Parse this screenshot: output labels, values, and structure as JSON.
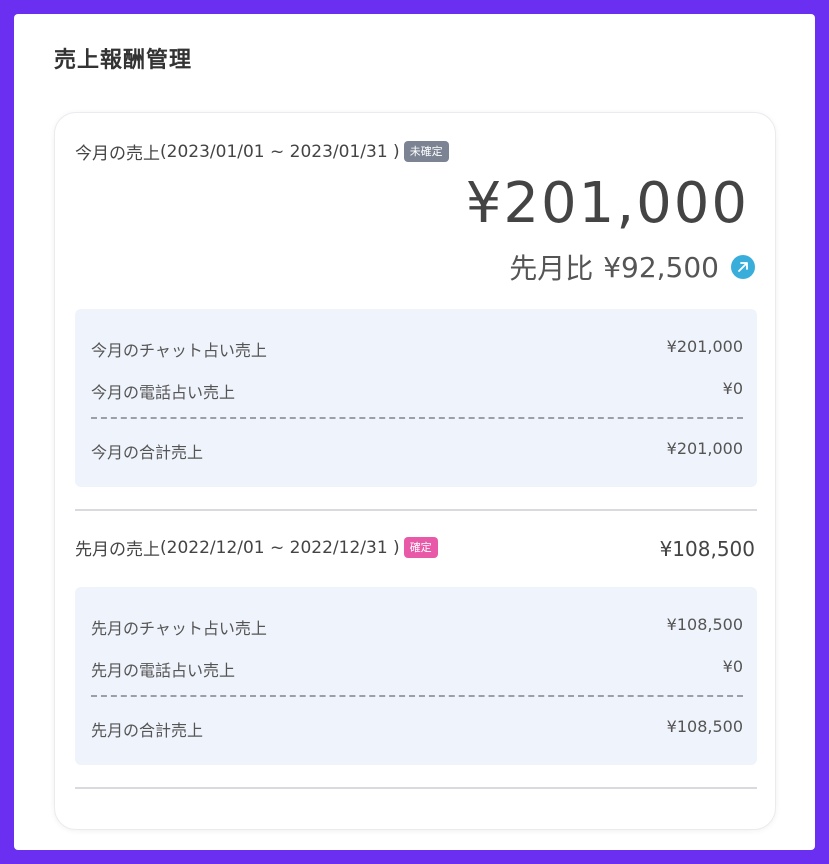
{
  "page": {
    "title": "売上報酬管理"
  },
  "current": {
    "heading_label": "今月の売上",
    "period": "(2023/01/01 ~ 2023/01/31 )",
    "status_badge": "未確定",
    "total_amount": "¥201,000",
    "compare_label": "先月比",
    "compare_amount": "¥92,500",
    "trend_icon": "arrow-up-right-icon",
    "rows": [
      {
        "label": "今月のチャット占い売上",
        "value": "¥201,000"
      },
      {
        "label": "今月の電話占い売上",
        "value": "¥0"
      },
      {
        "label": "今月の合計売上",
        "value": "¥201,000"
      }
    ]
  },
  "previous": {
    "heading_label": "先月の売上",
    "period": "(2022/12/01 ~ 2022/12/31 )",
    "status_badge": "確定",
    "total_amount": "¥108,500",
    "rows": [
      {
        "label": "先月のチャット占い売上",
        "value": "¥108,500"
      },
      {
        "label": "先月の電話占い売上",
        "value": "¥0"
      },
      {
        "label": "先月の合計売上",
        "value": "¥108,500"
      }
    ]
  },
  "colors": {
    "frame_border": "#6a2ff0",
    "badge_pending": "#7c8494",
    "badge_confirmed": "#e85aa8",
    "trend_icon": "#3aaedb",
    "breakdown_bg": "#eff3fb"
  }
}
